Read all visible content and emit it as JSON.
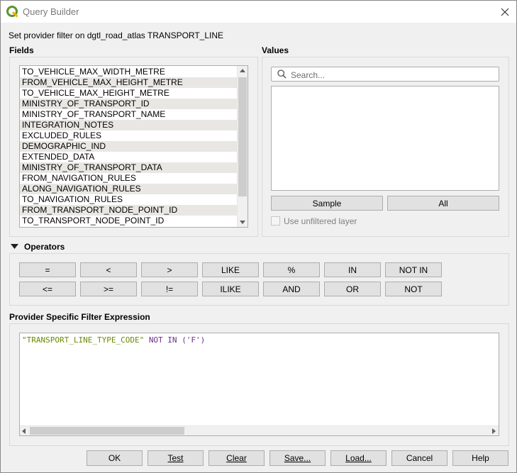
{
  "window": {
    "title": "Query Builder",
    "provider_text": "Set provider filter on dgtl_road_atlas TRANSPORT_LINE"
  },
  "fields": {
    "title": "Fields",
    "items": [
      "TO_VEHICLE_MAX_WIDTH_METRE",
      "FROM_VEHICLE_MAX_HEIGHT_METRE",
      "TO_VEHICLE_MAX_HEIGHT_METRE",
      "MINISTRY_OF_TRANSPORT_ID",
      "MINISTRY_OF_TRANSPORT_NAME",
      "INTEGRATION_NOTES",
      "EXCLUDED_RULES",
      "DEMOGRAPHIC_IND",
      "EXTENDED_DATA",
      "MINISTRY_OF_TRANSPORT_DATA",
      "FROM_NAVIGATION_RULES",
      "ALONG_NAVIGATION_RULES",
      "TO_NAVIGATION_RULES",
      "FROM_TRANSPORT_NODE_POINT_ID",
      "TO_TRANSPORT_NODE_POINT_ID"
    ]
  },
  "values": {
    "title": "Values",
    "search_placeholder": "Search...",
    "sample_label": "Sample",
    "all_label": "All",
    "unfiltered_label": "Use unfiltered layer"
  },
  "operators": {
    "title": "Operators",
    "row1": [
      "=",
      "<",
      ">",
      "LIKE",
      "%",
      "IN",
      "NOT IN"
    ],
    "row2": [
      "<=",
      ">=",
      "!=",
      "ILIKE",
      "AND",
      "OR",
      "NOT"
    ]
  },
  "expression": {
    "title": "Provider Specific Filter Expression",
    "field": "\"TRANSPORT_LINE_TYPE_CODE\"",
    "operator": "NOT IN",
    "value": "('F')"
  },
  "footer": {
    "ok": "OK",
    "test": "Test",
    "clear": "Clear",
    "save": "Save...",
    "load": "Load...",
    "cancel": "Cancel",
    "help": "Help"
  },
  "icons": {
    "app": "qgis-icon",
    "close": "close-icon",
    "search": "search-icon",
    "collapse": "triangle-down-icon"
  },
  "colors": {
    "field_token": "#6a8a00",
    "operator_token": "#6a2e8e",
    "alt_row": "#e9e7e3"
  }
}
